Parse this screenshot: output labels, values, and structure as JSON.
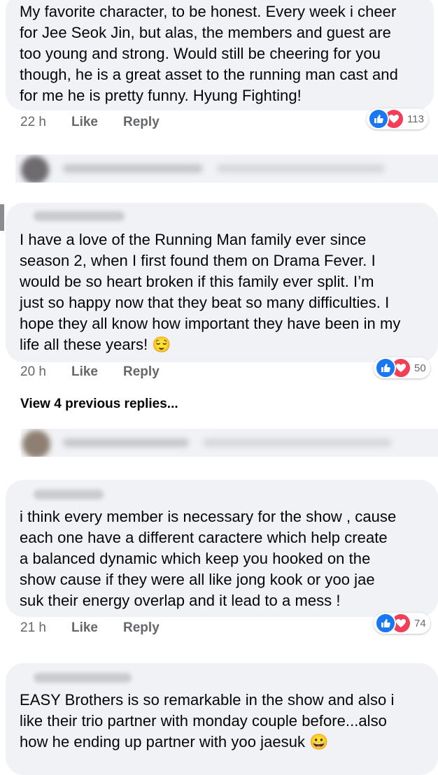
{
  "comments": [
    {
      "text": "My favorite character, to be honest. Every week i cheer\nfor Jee Seok Jin, but alas, the members and guest are\ntoo young and strong. Would still be cheering for you\nthough, he is a great asset to the running man cast and\nfor me he is pretty funny. Hyung Fighting!",
      "time": "22 h",
      "like": "Like",
      "reply": "Reply",
      "reactions": "113"
    },
    {
      "text": "I have a love of the Running Man family ever since\nseason 2, when I first found them on Drama Fever.  I\nwould be so heart broken if this family ever split.  I’m\njust so happy now that they beat so many difficulties.  I\nhope they all know how important they have been in my\nlife all these years! 😌",
      "time": "20 h",
      "like": "Like",
      "reply": "Reply",
      "reactions": "50"
    },
    {
      "text": "i think every member is necessary for the show , cause\neach one have a different caractere which help create\na balanced dynamic which keep you hooked on the\nshow cause if they were all like jong kook or yoo jae\nsuk their energy overlap and it lead to a mess !",
      "time": "21 h",
      "like": "Like",
      "reply": "Reply",
      "reactions": "74"
    },
    {
      "text": "EASY Brothers is so remarkable in the show and also i\nlike their  trio partner with monday couple before...also\nhow he ending up partner with yoo jaesuk 😀"
    }
  ],
  "view_previous": "View 4 previous replies...",
  "icons": {
    "like": "thumbs-up-icon",
    "love": "heart-icon"
  },
  "colors": {
    "like": "#1877f2",
    "love": "#f33e58",
    "bubble": "#f0f2f5",
    "meta": "#65676b"
  }
}
